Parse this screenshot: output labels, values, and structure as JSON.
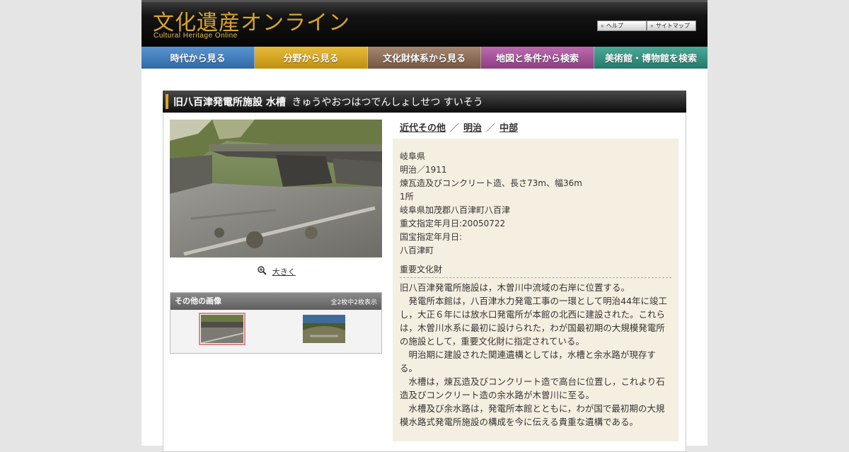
{
  "header": {
    "logo_jp": "文化遺産オンライン",
    "logo_en": "Cultural Heritage Online",
    "help_label": "ヘルプ",
    "sitemap_label": "サイトマップ"
  },
  "nav": {
    "items": [
      {
        "label": "時代から見る",
        "color": "#3f7ec0"
      },
      {
        "label": "分野から見る",
        "color": "#d4a31e"
      },
      {
        "label": "文化財体系から見る",
        "color": "#8a6a55"
      },
      {
        "label": "地図と条件から検索",
        "color": "#a24f95"
      },
      {
        "label": "美術館・博物館を検索",
        "color": "#2f8f7f"
      }
    ]
  },
  "title": {
    "main": "旧八百津発電所施設 水槽",
    "reading": "きゅうやおつはつでんしょしせつ すいそう"
  },
  "image": {
    "enlarge_label": "大きく",
    "others_title": "その他の画像",
    "others_count": "全2枚中2枚表示"
  },
  "breadcrumbs": [
    "近代その他",
    "明治",
    "中部"
  ],
  "info": {
    "prefecture": "岐阜県",
    "era_year": "明治／1911",
    "structure": "煉瓦造及びコンクリート造、長さ73m、幅36m",
    "quantity": "1所",
    "location": "岐阜県加茂郡八百津町八百津",
    "designation_date": "重文指定年月日:20050722",
    "national_treasure_date": "国宝指定年月日:",
    "owner": "八百津町",
    "category": "重要文化財",
    "description": [
      "旧八百津発電所施設は，木曽川中流域の右岸に位置する。",
      "　発電所本館は，八百津水力発電工事の一環として明治44年に竣工し，大正６年には放水口発電所が本館の北西に建設された。これらは，木曽川水系に最初に設けられた，わが国最初期の大規模発電所の施設として，重要文化財に指定されている。",
      "　明治期に建設された関連遺構としては，水槽と余水路が現存する。",
      "　水槽は，煉瓦造及びコンクリート造で高台に位置し，これより石造及びコンクリート造の余水路が木曽川に至る。",
      "　水槽及び余水路は，発電所本館とともに，わが国で最初期の大規模水路式発電所施設の構成を今に伝える貴重な遺構である。"
    ]
  }
}
